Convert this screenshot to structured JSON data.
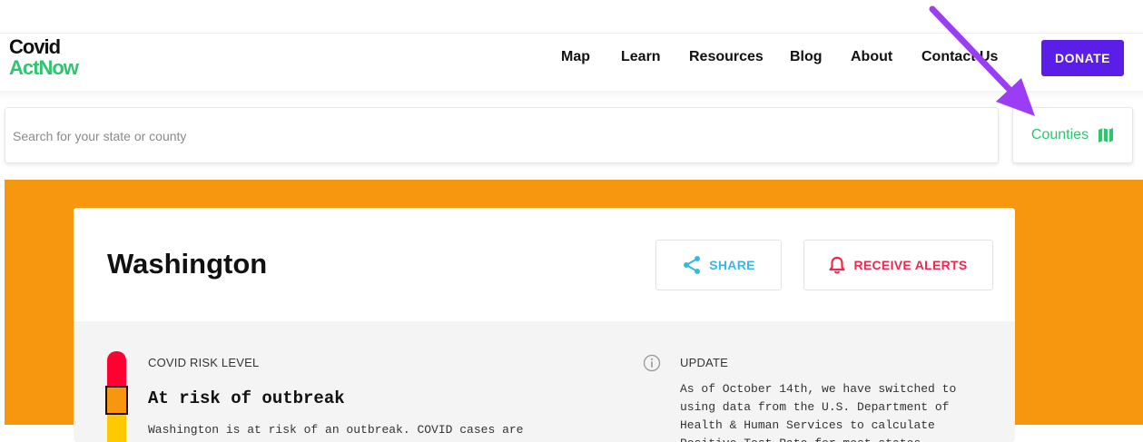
{
  "logo": {
    "line1": "Covid",
    "line2": "ActNow"
  },
  "nav": {
    "items": [
      "Map",
      "Learn",
      "Resources",
      "Blog",
      "About",
      "Contact Us"
    ],
    "donate_label": "DONATE"
  },
  "search": {
    "placeholder": "Search for your state or county",
    "counties_label": "Counties"
  },
  "card": {
    "title": "Washington",
    "share_label": "SHARE",
    "alerts_label": "RECEIVE ALERTS",
    "risk": {
      "label": "COVID RISK LEVEL",
      "level": "At risk of outbreak",
      "description": "Washington is at risk of an outbreak. COVID cases are"
    },
    "update": {
      "label": "UPDATE",
      "text": "As of October 14th, we have switched to using data from the U.S. Department of Health & Human Services to calculate Positive Test Rate for most states"
    }
  },
  "colors": {
    "brand_green": "#2ec56f",
    "donate_purple": "#5b1ee8",
    "risk_orange": "#f7960f",
    "risk_red": "#ff0033",
    "risk_yellow": "#ffc900",
    "share_blue": "#3bb7e4",
    "alert_red": "#f0274f",
    "annotation_arrow": "#9b3df5"
  },
  "icons": {
    "counties": "map-icon",
    "share": "share-icon",
    "alerts": "bell-icon",
    "update": "info-icon"
  }
}
